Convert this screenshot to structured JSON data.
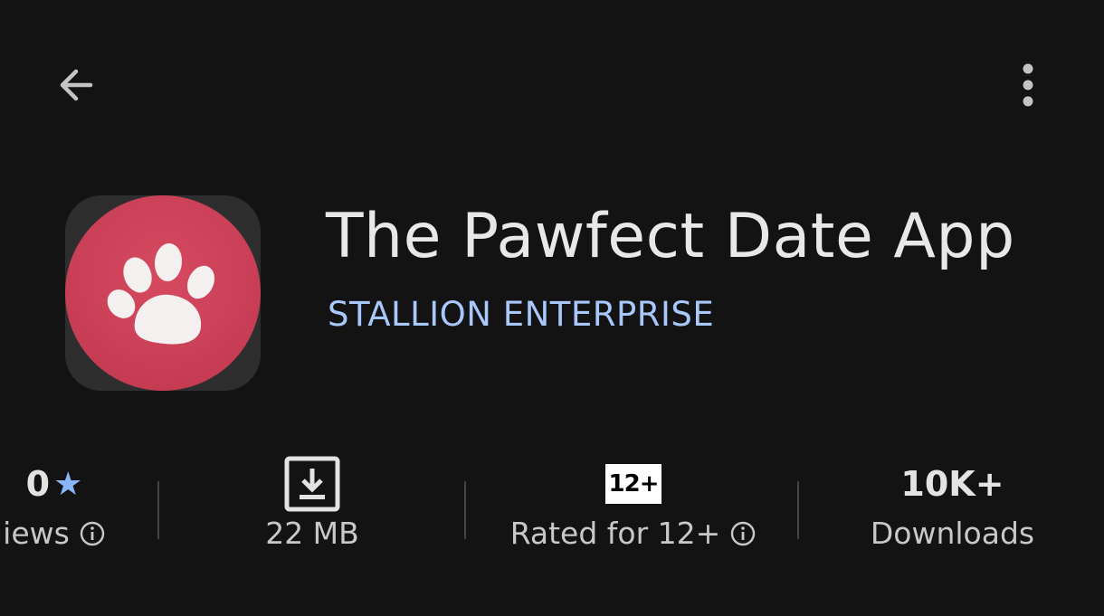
{
  "toolbar": {
    "back_icon": "arrow-back-icon",
    "more_icon": "more-vert-icon"
  },
  "app": {
    "title": "The Pawfect Date App",
    "developer": "STALLION ENTERPRISE",
    "icon": "paw-icon",
    "brand_color": "#d44a5e",
    "accent_color": "#a8c7fa"
  },
  "stats": {
    "rating": {
      "value": "0",
      "label": "iews",
      "star_icon": "star-icon",
      "info_icon": "info-icon"
    },
    "size": {
      "label": "22 MB",
      "icon": "download-icon"
    },
    "content_rating": {
      "badge": "12+",
      "label": "Rated for 12+",
      "info_icon": "info-icon"
    },
    "downloads": {
      "value": "10K+",
      "label": "Downloads"
    }
  }
}
